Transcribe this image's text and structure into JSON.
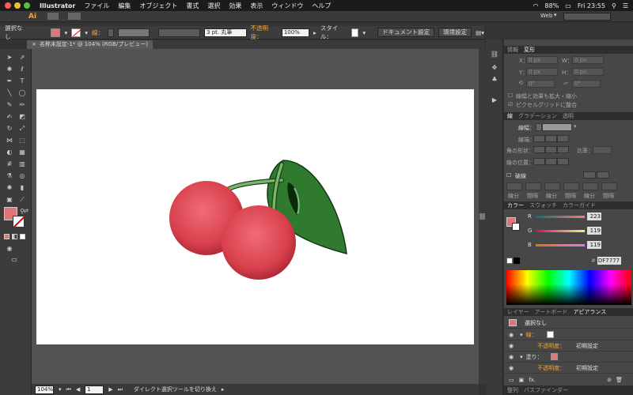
{
  "menubar": {
    "app": "Illustrator",
    "items": [
      "ファイル",
      "編集",
      "オブジェクト",
      "書式",
      "選択",
      "効果",
      "表示",
      "ウィンドウ",
      "ヘルプ"
    ],
    "battery": "88%",
    "clock": "Fri 23:55"
  },
  "topbar": {
    "ai_logo": "Ai",
    "workspace": "Web"
  },
  "control": {
    "selection": "選択なし",
    "stroke_label": "線：",
    "brush": "3 pt. 丸筆",
    "opacity_label": "不透明度：",
    "opacity_value": "100%",
    "style_label": "スタイル：",
    "doc_settings": "ドキュメント設定",
    "prefs": "環境設定"
  },
  "document_tab": {
    "title": "名称未設定-1* @ 104% (RGB/プレビュー)"
  },
  "status": {
    "zoom": "104%",
    "page": "1",
    "message": "ダイレクト選択ツールを切り換え"
  },
  "transform_panel": {
    "tabs": [
      "情報",
      "変形"
    ],
    "x_label": "X：",
    "x_value": "0 px",
    "y_label": "Y：",
    "y_value": "0 px",
    "w_label": "W：",
    "w_value": "0 px",
    "h_label": "H：",
    "h_value": "0 px",
    "angle": "0°",
    "shear": "0°",
    "scale_strokes": "線幅と効果も拡大・縮小",
    "pixel_grid": "ピクセルグリッドに整合"
  },
  "stroke_panel": {
    "tabs": [
      "線",
      "グラデーション",
      "透明"
    ],
    "weight_label": "線幅：",
    "cap_label": "線端：",
    "corner_label": "角の形状：",
    "limit_label": "比率：",
    "align_label": "線の位置：",
    "dashed_label": "破線",
    "dash_labels": [
      "線分",
      "間隔",
      "線分",
      "間隔",
      "線分",
      "間隔"
    ]
  },
  "color_panel": {
    "tabs": [
      "カラー",
      "スウォッチ",
      "カラーガイド"
    ],
    "r_label": "R",
    "r_value": "223",
    "g_label": "G",
    "g_value": "119",
    "b_label": "B",
    "b_value": "119",
    "hex_label": "#",
    "hex": "DF7777",
    "fill_color": "#df7777"
  },
  "appearance_panel": {
    "tabs": [
      "レイヤー",
      "アートボード",
      "アピアランス"
    ],
    "header": "選択なし",
    "stroke_label": "線：",
    "opacity_label": "不透明度：",
    "opacity_value": "初期設定",
    "fill_label": "塗り：",
    "opacity2_label": "不透明度：",
    "opacity2_value": "初期設定",
    "fx": "fx."
  },
  "bottom_tabs": [
    "整列",
    "パスファインダー"
  ],
  "colors": {
    "accent_orange": "#f2a43a",
    "cherry": "#d9434e",
    "leaf": "#2f7a2f",
    "fill": "#df7777"
  }
}
